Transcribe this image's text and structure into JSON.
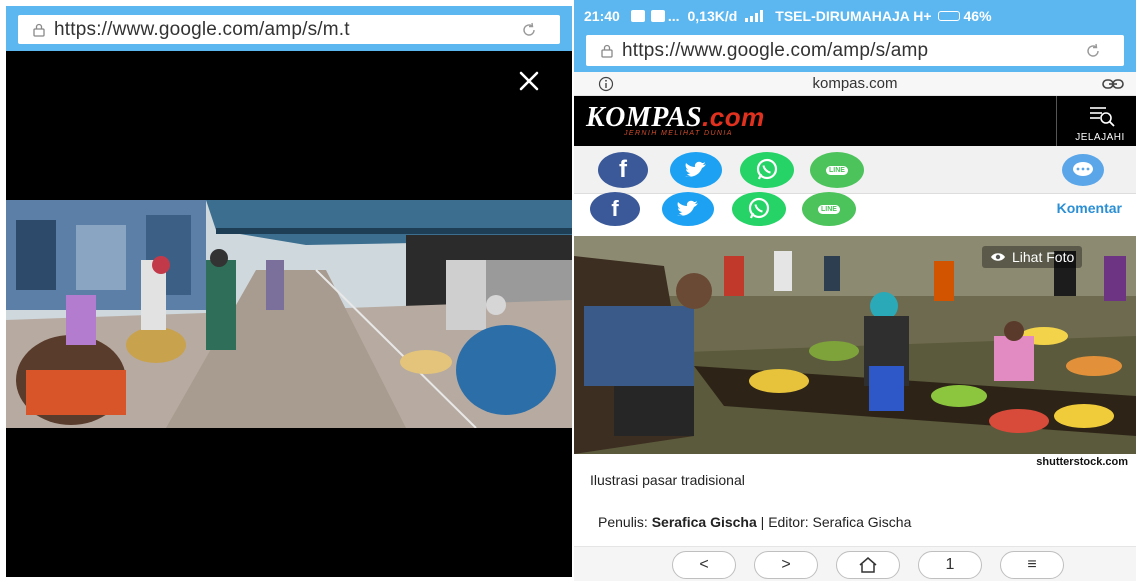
{
  "left_screen": {
    "url": "https://www.google.com/amp/s/m.t",
    "icons": [
      "lock-icon",
      "reload-icon",
      "close-icon"
    ],
    "photo_alt_scene": "street market"
  },
  "right_screen": {
    "status": {
      "time": "21:40",
      "dots": "...",
      "speed": "0,13K/d",
      "carrier": "TSEL-DIRUMAHAJA H+",
      "battery": "46%"
    },
    "url": "https://www.google.com/amp/s/amp",
    "site_domain": "kompas.com",
    "logo": {
      "brand": "KOMPAS",
      "tld": ".com",
      "tagline": "JERNIH MELIHAT DUNIA"
    },
    "jelajahi": "JELAJAHI",
    "share": {
      "facebook": "f",
      "line": "LINE",
      "komentar": "Komentar"
    },
    "lihat_foto": "Lihat Foto",
    "photo_credit": "shutterstock.com",
    "caption": "Ilustrasi pasar tradisional",
    "byline": {
      "penulis_label": "Penulis:",
      "penulis": "Serafica Gischa",
      "separator": "|",
      "editor_label": "Editor:",
      "editor": "Serafica Gischa"
    },
    "nav": {
      "back": "<",
      "forward": ">",
      "tabs_count": "1",
      "menu": "≡"
    },
    "colors": {
      "chrome_blue": "#5cb7f0",
      "facebook": "#3b5998",
      "twitter": "#1da1f2",
      "whatsapp": "#25d366",
      "line": "#4cc35b",
      "kompas_red": "#e0301e",
      "komentar_link": "#2a8fd5"
    }
  }
}
